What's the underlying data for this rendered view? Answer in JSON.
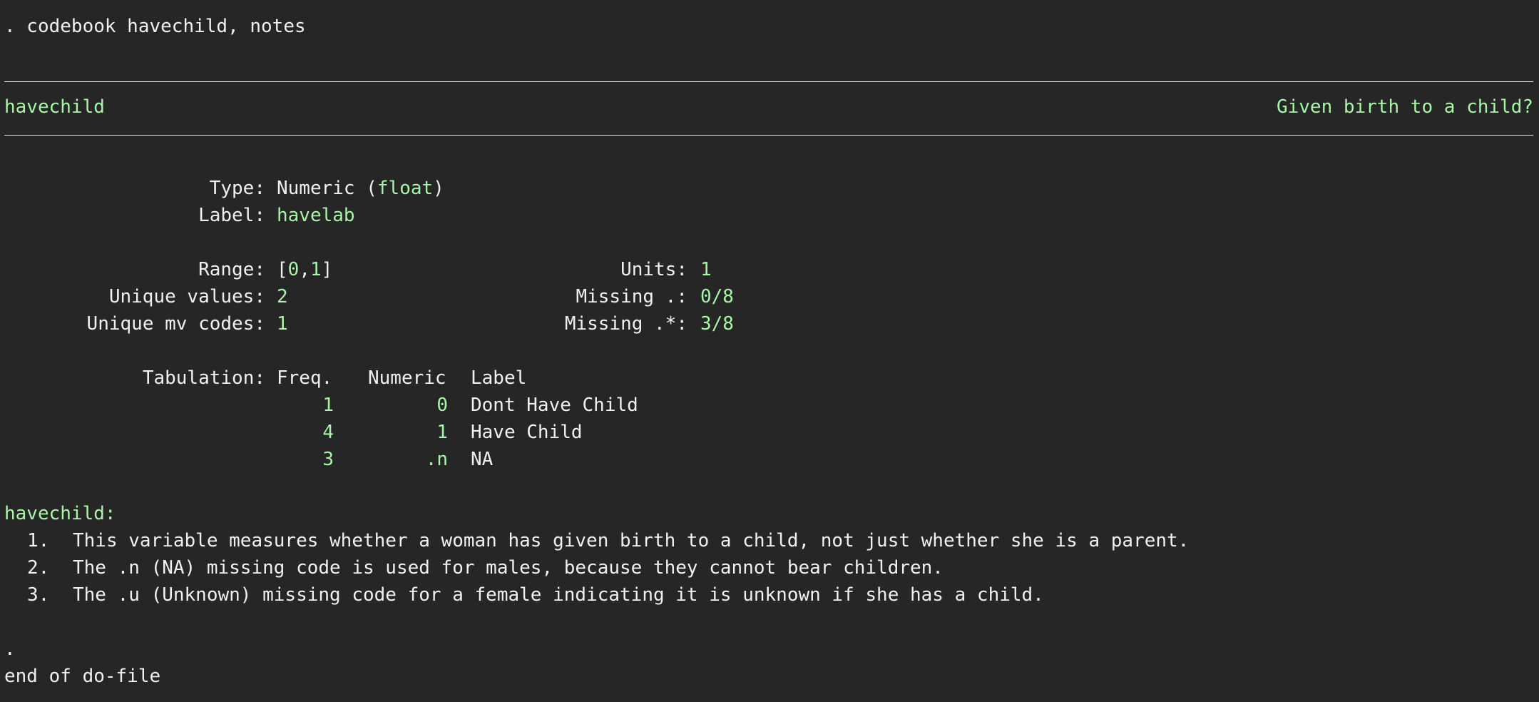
{
  "command": ". codebook havechild, notes",
  "header": {
    "varname": "havechild",
    "varlabel": "Given birth to a child?"
  },
  "fields": {
    "type_label": "Type:",
    "type_value_prefix": "Numeric (",
    "type_value_storage": "float",
    "type_value_suffix": ")",
    "label_label": "Label:",
    "label_value": "havelab",
    "range_label": "Range:",
    "range_open": "[",
    "range_lo": "0",
    "range_comma": ",",
    "range_hi": "1",
    "range_close": "]",
    "units_label": "Units:",
    "units_value": "1",
    "unique_values_label": "Unique values:",
    "unique_values_value": "2",
    "missing_dot_label": "Missing .:",
    "missing_dot_value": "0/8",
    "unique_mv_label": "Unique mv codes:",
    "unique_mv_value": "1",
    "missing_star_label": "Missing .*:",
    "missing_star_value": "3/8"
  },
  "tabulation": {
    "label": "Tabulation:",
    "headers": [
      "Freq.",
      "Numeric",
      "Label"
    ],
    "rows": [
      {
        "freq": "1",
        "numeric": "0",
        "label": "Dont Have Child"
      },
      {
        "freq": "4",
        "numeric": "1",
        "label": "Have Child"
      },
      {
        "freq": "3",
        "numeric": ".n",
        "label": "NA"
      }
    ]
  },
  "notes": {
    "title": "havechild:",
    "items": [
      {
        "num": "1.",
        "text": "This variable measures whether a woman has given birth to a child, not just whether she is a parent."
      },
      {
        "num": "2.",
        "text": "The .n (NA) missing code is used for males, because they cannot bear children."
      },
      {
        "num": "3.",
        "text": "The .u (Unknown) missing code for a female indicating it is unknown if she has a child."
      }
    ]
  },
  "footer": {
    "dot": ".",
    "end": "end of do-file"
  },
  "colors": {
    "background": "#262626",
    "text": "#f0f0f0",
    "result": "#a8f5a8"
  }
}
